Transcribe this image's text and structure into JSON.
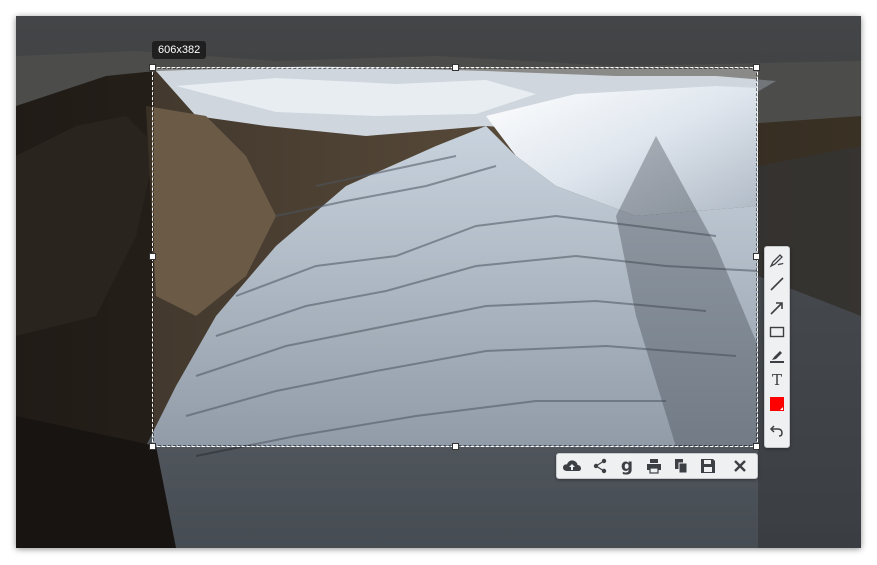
{
  "selection": {
    "size_label": "606x382"
  },
  "colors": {
    "pen_color": "#ff0000",
    "toolbar_bg": "#eef0f2",
    "icon": "#3c3f43"
  },
  "vertical_toolbar": [
    {
      "icon": "freehand-pen-icon",
      "tooltip": ""
    },
    {
      "icon": "line-icon",
      "tooltip": ""
    },
    {
      "icon": "arrow-icon",
      "tooltip": ""
    },
    {
      "icon": "rectangle-icon",
      "tooltip": ""
    },
    {
      "icon": "marker-icon",
      "tooltip": ""
    },
    {
      "icon": "text-icon",
      "tooltip": ""
    },
    {
      "icon": "color-picker-icon",
      "tooltip": ""
    },
    {
      "icon": "undo-icon",
      "tooltip": ""
    }
  ],
  "text_tool_glyph": "T",
  "horizontal_toolbar": [
    {
      "icon": "cloud-upload-icon"
    },
    {
      "icon": "share-icon"
    },
    {
      "icon": "google-search-icon"
    },
    {
      "icon": "print-icon"
    },
    {
      "icon": "copy-icon"
    },
    {
      "icon": "save-icon"
    },
    {
      "icon": "close-icon"
    }
  ],
  "google_glyph": "g"
}
